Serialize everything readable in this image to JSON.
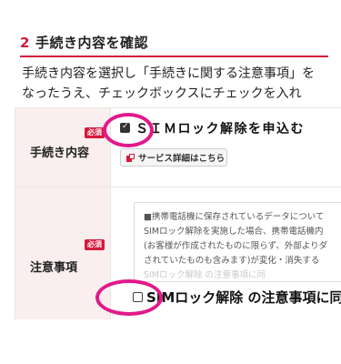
{
  "section": {
    "number": "2",
    "title": "手続き内容を確認"
  },
  "intro": {
    "line1": "手続き内容を選択し「手続きに関する注意事項」を",
    "line2": "なったうえ、チェックボックスにチェックを入れ"
  },
  "rows": {
    "procedure": {
      "label": "手続き内容",
      "required_badge": "必須",
      "option_label": "ＳＩＭロック解除を申込む",
      "option_checked": true,
      "service_button": "サービス詳細はこちら"
    },
    "notes": {
      "label": "注意事項",
      "required_badge": "必須",
      "notice_lines": [
        "■携帯電話機に保存されているデータについて",
        "SIMロック解除を実施した場合、携帯電話機内",
        "(お客様が作成されたものに限らず、外部よりダ",
        "されていたものも含みます)が変化・消失する",
        "SIMロック解除 の注意事項に同"
      ],
      "agree_label": "SIMロック解除 の注意事項に同",
      "agree_checked": false
    }
  },
  "colors": {
    "accent": "#d7173a",
    "highlight_ring": "#e2188a",
    "header_cell_bg": "#fbeeee"
  }
}
